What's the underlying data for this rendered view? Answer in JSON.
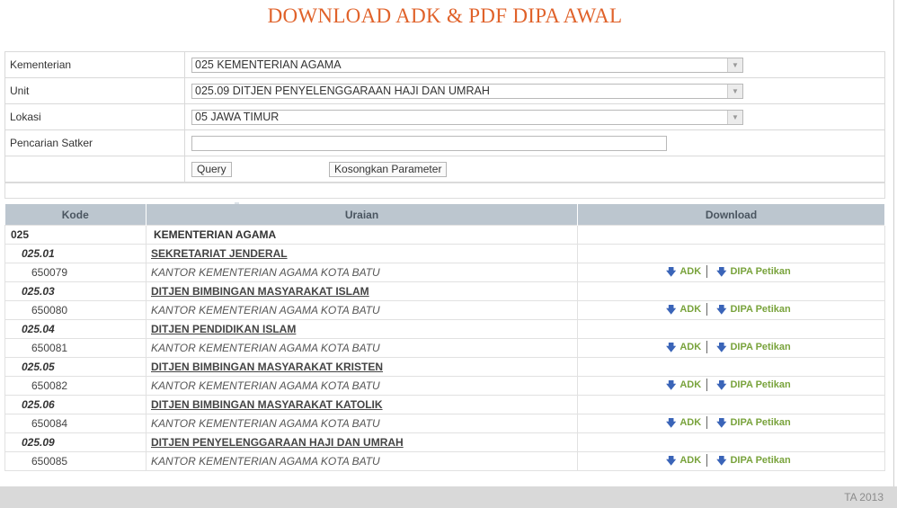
{
  "page": {
    "title": "DOWNLOAD ADK & PDF DIPA AWAL",
    "footer": "TA 2013"
  },
  "form": {
    "kementerian": {
      "label": "Kementerian",
      "value": "025  KEMENTERIAN AGAMA"
    },
    "unit": {
      "label": "Unit",
      "value": "025.09  DITJEN PENYELENGGARAAN HAJI DAN UMRAH"
    },
    "lokasi": {
      "label": "Lokasi",
      "value": "05  JAWA TIMUR"
    },
    "satker": {
      "label": "Pencarian Satker",
      "value": ""
    },
    "query_label": "Query",
    "reset_label": "Kosongkan Parameter"
  },
  "grid": {
    "headers": {
      "kode": "Kode",
      "uraian": "Uraian",
      "download": "Download"
    },
    "download_labels": {
      "adk": "ADK",
      "dipa": "DIPA Petikan"
    },
    "rows": [
      {
        "level": 0,
        "kode": "025",
        "uraian": "KEMENTERIAN AGAMA"
      },
      {
        "level": 1,
        "kode": "025.01",
        "uraian": "SEKRETARIAT JENDERAL"
      },
      {
        "level": 2,
        "kode": "650079",
        "uraian": "KANTOR KEMENTERIAN AGAMA KOTA BATU"
      },
      {
        "level": 1,
        "kode": "025.03",
        "uraian": "DITJEN BIMBINGAN MASYARAKAT ISLAM"
      },
      {
        "level": 2,
        "kode": "650080",
        "uraian": "KANTOR KEMENTERIAN AGAMA KOTA BATU"
      },
      {
        "level": 1,
        "kode": "025.04",
        "uraian": "DITJEN PENDIDIKAN ISLAM"
      },
      {
        "level": 2,
        "kode": "650081",
        "uraian": "KANTOR KEMENTERIAN AGAMA KOTA BATU"
      },
      {
        "level": 1,
        "kode": "025.05",
        "uraian": "DITJEN BIMBINGAN MASYARAKAT KRISTEN"
      },
      {
        "level": 2,
        "kode": "650082",
        "uraian": "KANTOR KEMENTERIAN AGAMA KOTA BATU"
      },
      {
        "level": 1,
        "kode": "025.06",
        "uraian": "DITJEN BIMBINGAN MASYARAKAT KATOLIK"
      },
      {
        "level": 2,
        "kode": "650084",
        "uraian": "KANTOR KEMENTERIAN AGAMA KOTA BATU"
      },
      {
        "level": 1,
        "kode": "025.09",
        "uraian": "DITJEN PENYELENGGARAAN HAJI DAN UMRAH"
      },
      {
        "level": 2,
        "kode": "650085",
        "uraian": "KANTOR KEMENTERIAN AGAMA KOTA BATU"
      }
    ]
  },
  "icons": {
    "download_arrow": "down-arrow-icon",
    "dropdown": "chevron-down-icon"
  },
  "colors": {
    "title": "#e0622a",
    "header_bg": "#bcc6cf",
    "link_green": "#79a33c",
    "arrow_blue": "#3a64b8"
  }
}
